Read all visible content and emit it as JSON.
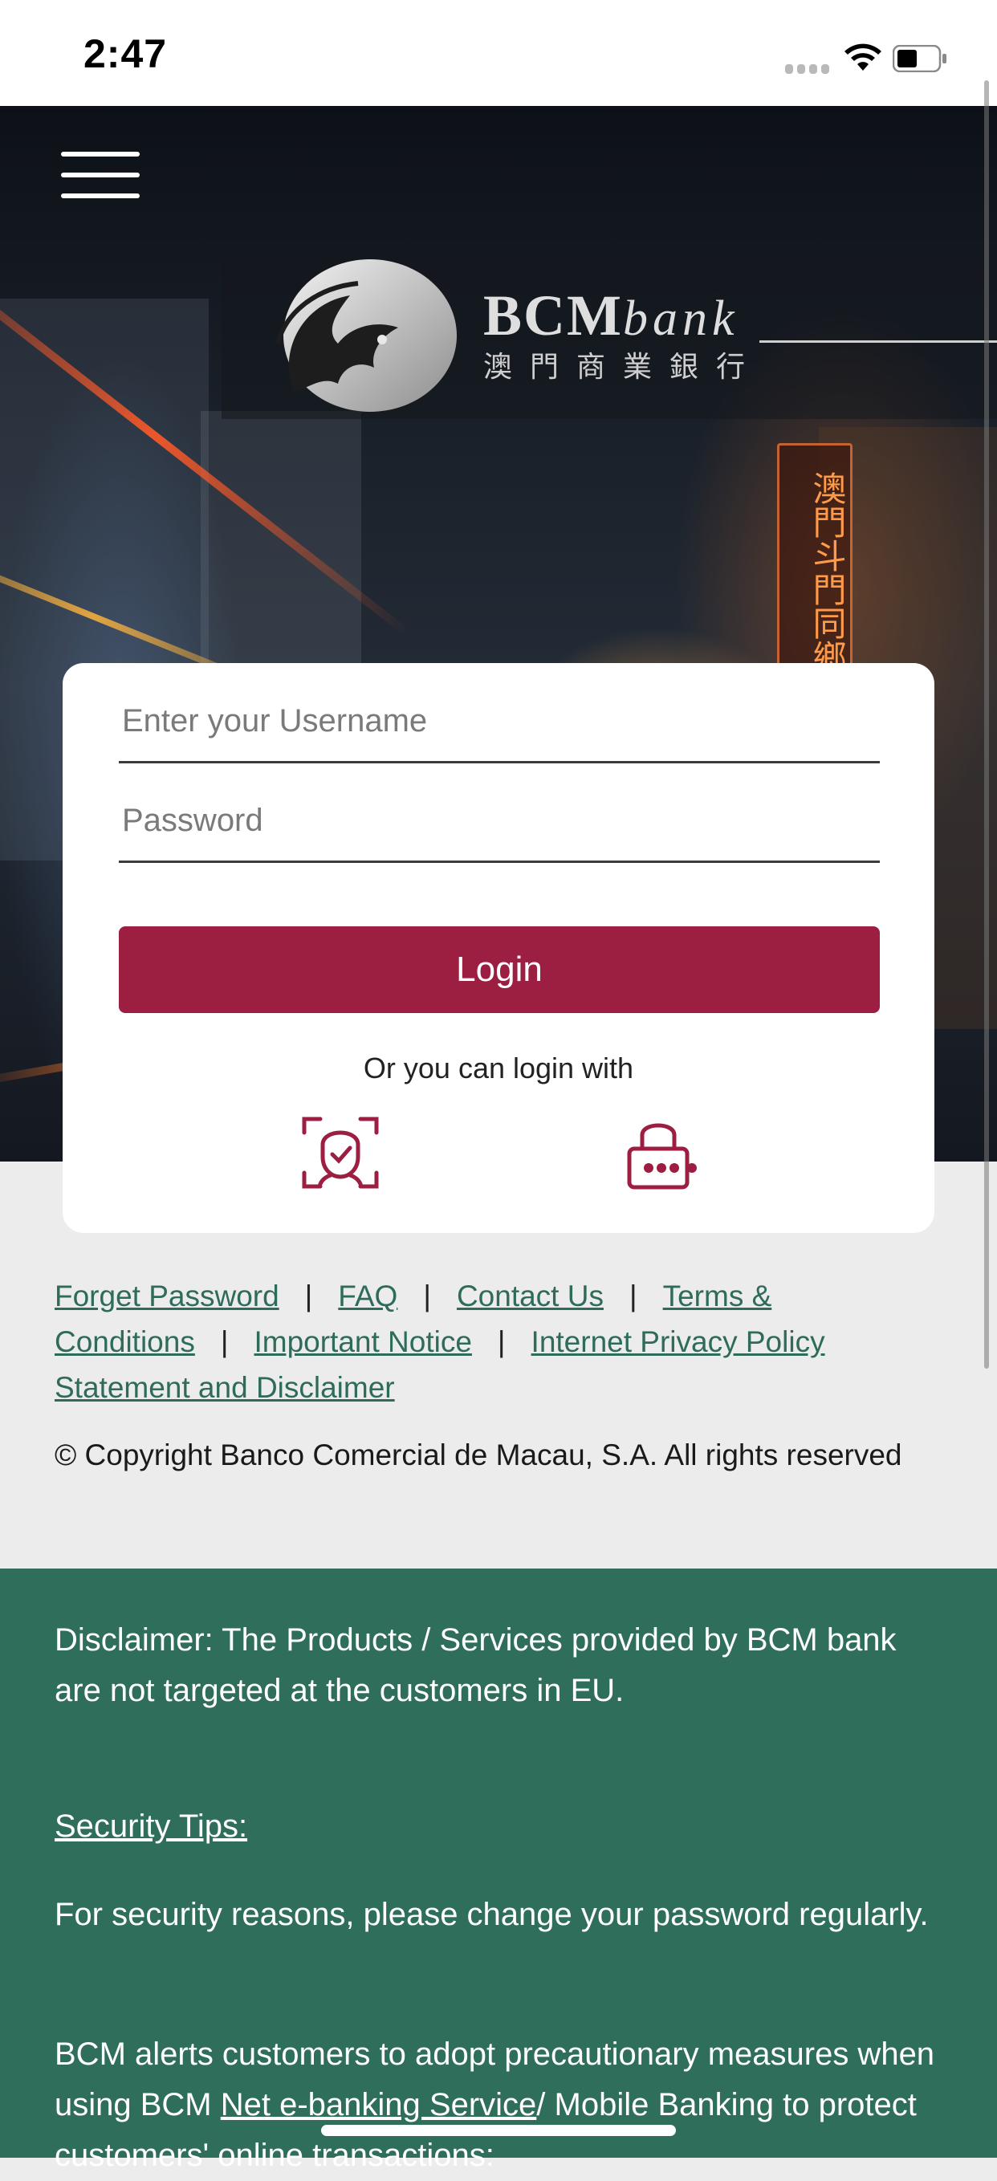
{
  "status_bar": {
    "time": "2:47"
  },
  "brand": {
    "name_main": "BCM",
    "name_italic": "bank",
    "name_cn": "澳門商業銀行",
    "sign_text": "澳門斗門同鄉總會"
  },
  "login": {
    "username_placeholder": "Enter your Username",
    "password_placeholder": "Password",
    "login_label": "Login",
    "alt_login_text": "Or you can login with"
  },
  "footer_links": {
    "forget_password": "Forget Password",
    "faq": "FAQ",
    "contact_us": "Contact Us",
    "terms": "Terms & Conditions",
    "important_notice": "Important Notice",
    "privacy": "Internet Privacy Policy Statement and Disclaimer",
    "separator": "|"
  },
  "copyright": "© Copyright Banco Comercial de Macau, S.A. All rights reserved",
  "disclaimer": {
    "text": "Disclaimer: The Products / Services provided by BCM bank are not targeted at the customers in EU.",
    "security_heading": "Security Tips:",
    "tip1": "For security reasons, please change your password regularly.",
    "tip2_before": "BCM alerts customers to adopt precautionary measures when using BCM ",
    "tip2_link": "Net e-banking Service",
    "tip2_after": "/ Mobile Banking to protect customers' online transactions:"
  },
  "colors": {
    "accent": "#9c1f42",
    "green": "#2f6e5a",
    "link": "#2f6b5a"
  },
  "icons": [
    "menu-icon",
    "face-id-icon",
    "pin-lock-icon",
    "wifi-icon",
    "battery-icon",
    "signal-icon"
  ]
}
